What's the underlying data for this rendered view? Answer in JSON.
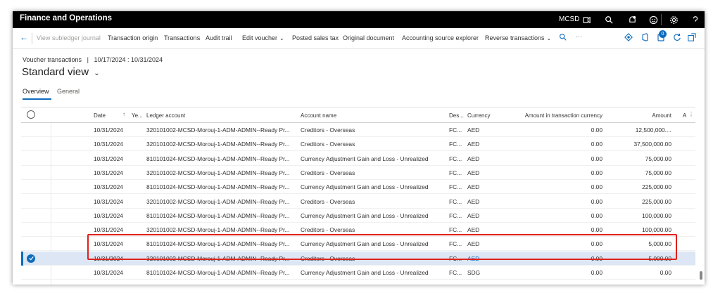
{
  "app": {
    "title": "Finance and Operations",
    "company": "MCSD"
  },
  "actions": {
    "back": "←",
    "items": [
      {
        "label": "View subledger journal",
        "disabled": true
      },
      {
        "label": "Transaction origin"
      },
      {
        "label": "Transactions"
      },
      {
        "label": "Audit trail"
      },
      {
        "label": "Edit voucher",
        "dropdown": true
      },
      {
        "label": "Posted sales tax"
      },
      {
        "label": "Original document"
      },
      {
        "label": "Accounting source explorer"
      },
      {
        "label": "Reverse transactions",
        "dropdown": true
      }
    ],
    "more": "···",
    "badge": "0"
  },
  "header": {
    "breadcrumb_prefix": "Voucher transactions",
    "breadcrumb_sep": "|",
    "breadcrumb_range": "10/17/2024 : 10/31/2024",
    "view_title": "Standard view"
  },
  "tabs": [
    {
      "label": "Overview"
    },
    {
      "label": "General"
    }
  ],
  "grid": {
    "columns": {
      "date": "Date",
      "year": "Ye...",
      "ledger": "Ledger account",
      "account_name": "Account name",
      "desc": "Des...",
      "currency": "Currency",
      "amount_tc": "Amount in transaction currency",
      "amount": "Amount",
      "extra": "A"
    },
    "sort_indicator": "↑",
    "rows": [
      {
        "date": "10/31/2024",
        "ledger": "320101002-MCSD-Morouj-1-ADM-ADMIN--Ready Pr...",
        "account_name": "Creditors - Overseas",
        "desc": "FC...",
        "currency": "AED",
        "amount_tc": "0.00",
        "amount": "12,500,000...."
      },
      {
        "date": "10/31/2024",
        "ledger": "320101002-MCSD-Morouj-1-ADM-ADMIN--Ready Pr...",
        "account_name": "Creditors - Overseas",
        "desc": "FC...",
        "currency": "AED",
        "amount_tc": "0.00",
        "amount": "37,500,000.00"
      },
      {
        "date": "10/31/2024",
        "ledger": "810101024-MCSD-Morouj-1-ADM-ADMIN--Ready Pr...",
        "account_name": "Currency Adjustment Gain and Loss - Unrealized",
        "desc": "FC...",
        "currency": "AED",
        "amount_tc": "0.00",
        "amount": "75,000.00"
      },
      {
        "date": "10/31/2024",
        "ledger": "320101002-MCSD-Morouj-1-ADM-ADMIN--Ready Pr...",
        "account_name": "Creditors - Overseas",
        "desc": "FC...",
        "currency": "AED",
        "amount_tc": "0.00",
        "amount": "75,000.00"
      },
      {
        "date": "10/31/2024",
        "ledger": "810101024-MCSD-Morouj-1-ADM-ADMIN--Ready Pr...",
        "account_name": "Currency Adjustment Gain and Loss - Unrealized",
        "desc": "FC...",
        "currency": "AED",
        "amount_tc": "0.00",
        "amount": "225,000.00"
      },
      {
        "date": "10/31/2024",
        "ledger": "320101002-MCSD-Morouj-1-ADM-ADMIN--Ready Pr...",
        "account_name": "Creditors - Overseas",
        "desc": "FC...",
        "currency": "AED",
        "amount_tc": "0.00",
        "amount": "225,000.00"
      },
      {
        "date": "10/31/2024",
        "ledger": "810101024-MCSD-Morouj-1-ADM-ADMIN--Ready Pr...",
        "account_name": "Currency Adjustment Gain and Loss - Unrealized",
        "desc": "FC...",
        "currency": "AED",
        "amount_tc": "0.00",
        "amount": "100,000.00"
      },
      {
        "date": "10/31/2024",
        "ledger": "320101002-MCSD-Morouj-1-ADM-ADMIN--Ready Pr...",
        "account_name": "Creditors - Overseas",
        "desc": "FC...",
        "currency": "AED",
        "amount_tc": "0.00",
        "amount": "100,000.00"
      },
      {
        "date": "10/31/2024",
        "ledger": "810101024-MCSD-Morouj-1-ADM-ADMIN--Ready Pr...",
        "account_name": "Currency Adjustment Gain and Loss - Unrealized",
        "desc": "FC...",
        "currency": "AED",
        "amount_tc": "0.00",
        "amount": "5,000.00"
      },
      {
        "date": "10/31/2024",
        "ledger": "320101002-MCSD-Morouj-1-ADM-ADMIN--Ready Pr...",
        "account_name": "Creditors - Overseas",
        "desc": "FC...",
        "currency": "AED",
        "amount_tc": "0.00",
        "amount": "5,000.00",
        "selected": true
      },
      {
        "date": "10/31/2024",
        "ledger": "810101024-MCSD-Morouj-1-ADM-ADMIN--Ready Pr...",
        "account_name": "Currency Adjustment Gain and Loss - Unrealized",
        "desc": "FC...",
        "currency": "SDG",
        "amount_tc": "0.00",
        "amount": "0.00"
      }
    ]
  },
  "colors": {
    "accent": "#0f6cbd",
    "selected_row": "#dce6f4",
    "highlight": "#e0201b"
  }
}
